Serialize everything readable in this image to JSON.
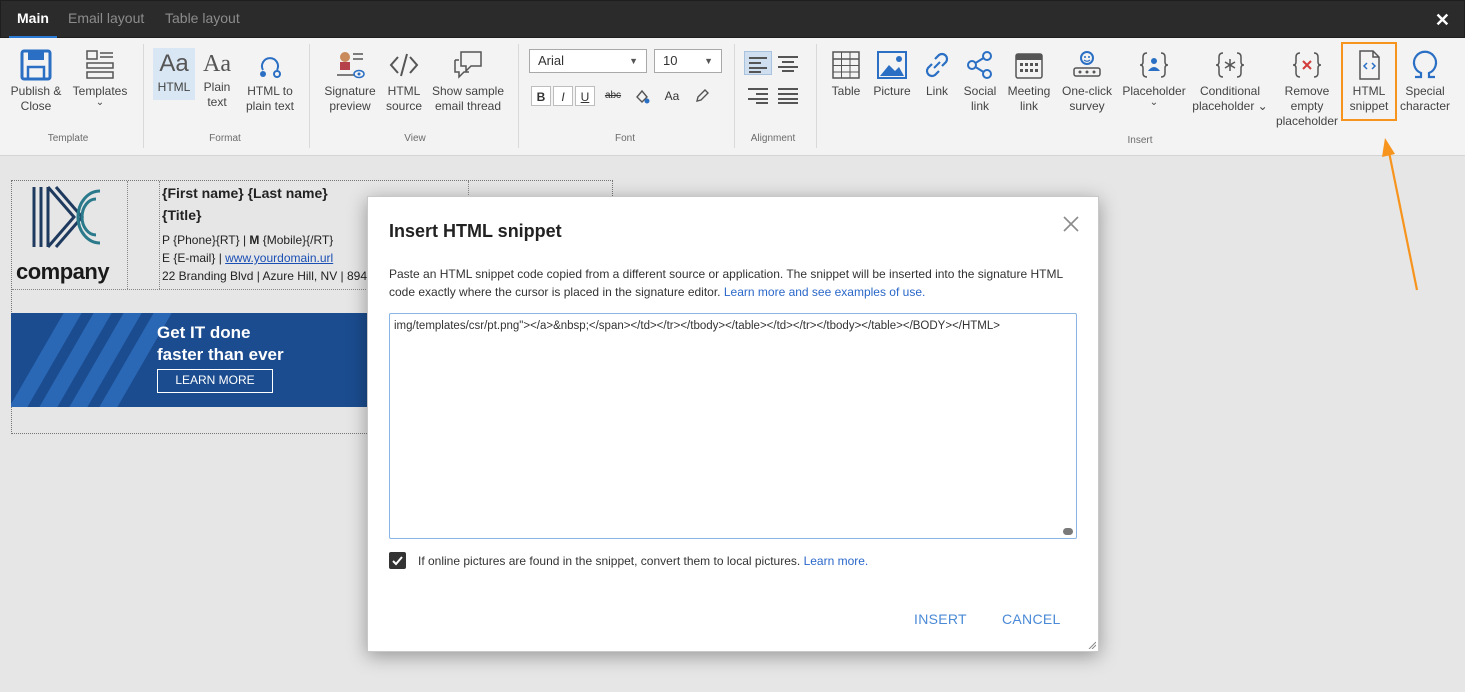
{
  "tabs": [
    {
      "label": "Main",
      "active": true
    },
    {
      "label": "Email layout",
      "active": false
    },
    {
      "label": "Table layout",
      "active": false
    }
  ],
  "window_close_glyph": "✕",
  "ribbon": {
    "groups": {
      "template": "Template",
      "format": "Format",
      "view": "View",
      "font": "Font",
      "alignment": "Alignment",
      "insert": "Insert"
    },
    "template": {
      "publish": [
        "Publish &",
        "Close"
      ],
      "templates": [
        "Templates",
        "⌄"
      ]
    },
    "format": {
      "html": "HTML",
      "plain": [
        "Plain",
        "text"
      ],
      "html_to_plain": [
        "HTML to",
        "plain text"
      ],
      "aa_glyph": "Aa"
    },
    "view": {
      "signature_preview": [
        "Signature",
        "preview"
      ],
      "html_source": [
        "HTML",
        "source"
      ],
      "sample_thread": [
        "Show sample",
        "email thread"
      ]
    },
    "font": {
      "family": "Arial",
      "size": "10",
      "bold": "B",
      "italic": "I",
      "underline": "U",
      "strike": "abc",
      "case": "Aa"
    },
    "insert": {
      "table": "Table",
      "picture": "Picture",
      "link": "Link",
      "social": [
        "Social",
        "link"
      ],
      "meeting": [
        "Meeting",
        "link"
      ],
      "survey": [
        "One-click",
        "survey"
      ],
      "placeholder": [
        "Placeholder",
        "⌄"
      ],
      "conditional": [
        "Conditional",
        "placeholder ⌄"
      ],
      "remove_empty": [
        "Remove",
        "empty",
        "placeholder"
      ],
      "html_snippet": [
        "HTML",
        "snippet"
      ],
      "special": [
        "Special",
        "character"
      ]
    }
  },
  "signature": {
    "logo_text": "company",
    "name": "{First name} {Last name}",
    "title": "{Title}",
    "phone_prefix": "P ",
    "phone_line": "{Phone}{RT} | ",
    "mobile_bold": "M",
    "mobile_rest": " {Mobile}{/RT}",
    "email_prefix": "E {E-mail} | ",
    "url": "www.yourdomain.url",
    "address": "22 Branding Blvd | Azure Hill, NV | 894",
    "banner_line1": "Get IT done",
    "banner_line2": "faster than ever",
    "banner_button": "LEARN MORE"
  },
  "dialog": {
    "title": "Insert HTML snippet",
    "description": "Paste an HTML snippet code copied from a different source or application. The snippet will be inserted into the signature HTML code exactly where the cursor is placed in the signature editor.",
    "learn_link": "Learn more and see examples of use.",
    "snippet_value": "img/templates/csr/pt.png\"></a>&nbsp;</span></td></tr></tbody></table></td></tr></tbody></table></BODY></HTML>",
    "checkbox_label": "If online pictures are found in the snippet, convert them to local pictures.",
    "checkbox_checked": true,
    "checkbox_link": "Learn more.",
    "insert_label": "INSERT",
    "cancel_label": "CANCEL"
  },
  "colors": {
    "accent": "#2a7ad4",
    "annotation": "#f7941d",
    "dialog_link": "#2a67c9",
    "dialog_button": "#4a8ad6",
    "banner": "#1b4c8f"
  }
}
